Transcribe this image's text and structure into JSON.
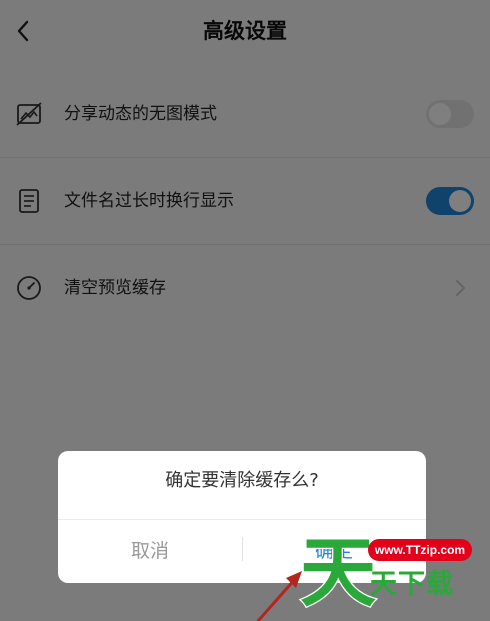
{
  "header": {
    "title": "高级设置",
    "back_icon": "chevron-left-icon"
  },
  "settings": [
    {
      "icon": "no-image-icon",
      "label": "分享动态的无图模式",
      "control": "toggle",
      "enabled": false
    },
    {
      "icon": "document-icon",
      "label": "文件名过长时换行显示",
      "control": "toggle",
      "enabled": true
    },
    {
      "icon": "gauge-icon",
      "label": "清空预览缓存",
      "control": "chevron"
    }
  ],
  "dialog": {
    "message": "确定要清除缓存么?",
    "cancel_label": "取消",
    "ok_label": "确定"
  },
  "watermark": {
    "big_char": "天",
    "url": "www.TTzip.com",
    "text": "天下载"
  },
  "colors": {
    "accent": "#1f86d6",
    "watermark_green": "#2ba83a",
    "watermark_red": "#e2001b",
    "overlay": "rgba(0,0,0,0.5)"
  }
}
